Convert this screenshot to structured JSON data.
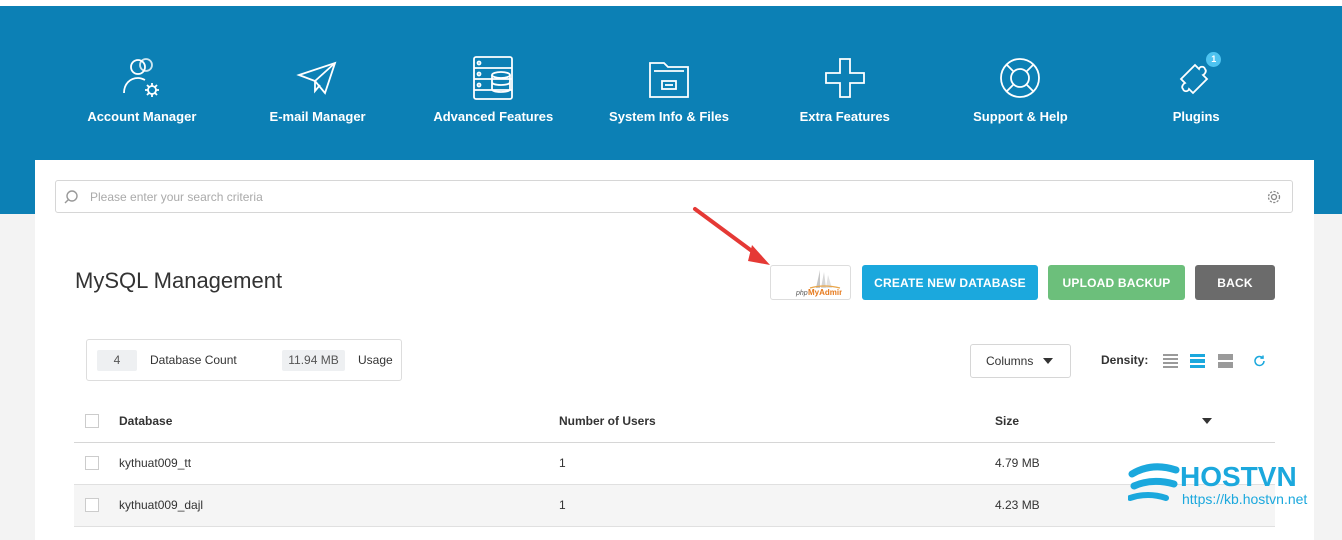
{
  "nav": {
    "items": [
      {
        "label": "Account Manager",
        "icon": "account-manager-icon"
      },
      {
        "label": "E-mail Manager",
        "icon": "paper-plane-icon"
      },
      {
        "label": "Advanced Features",
        "icon": "server-database-icon"
      },
      {
        "label": "System Info & Files",
        "icon": "folder-icon"
      },
      {
        "label": "Extra Features",
        "icon": "plus-icon"
      },
      {
        "label": "Support & Help",
        "icon": "lifebuoy-icon"
      },
      {
        "label": "Plugins",
        "icon": "puzzle-icon",
        "badge": "1"
      }
    ]
  },
  "search": {
    "placeholder": "Please enter your search criteria"
  },
  "page": {
    "title": "MySQL Management"
  },
  "actions": {
    "phpmyadmin_php": "php",
    "phpmyadmin_brand": "MyAdmin",
    "create_label": "CREATE NEW DATABASE",
    "upload_label": "UPLOAD BACKUP",
    "back_label": "BACK"
  },
  "stats": {
    "db_count": "4",
    "db_count_label": "Database Count",
    "usage": "11.94 MB",
    "usage_label": "Usage"
  },
  "toolbar": {
    "columns_label": "Columns",
    "density_label": "Density:"
  },
  "table": {
    "headers": {
      "database": "Database",
      "users": "Number of Users",
      "size": "Size"
    },
    "rows": [
      {
        "database": "kythuat009_tt",
        "users": "1",
        "size": "4.79 MB"
      },
      {
        "database": "kythuat009_dajl",
        "users": "1",
        "size": "4.23 MB"
      }
    ]
  },
  "watermark": {
    "brand": "HOSTVN",
    "url": "https://kb.hostvn.net"
  },
  "colors": {
    "header_bg": "#0c80b5",
    "create_button": "#1ba8dd",
    "upload_button": "#6cbf7b",
    "back_button": "#6b6b6b",
    "accent": "#1ba8dd"
  }
}
